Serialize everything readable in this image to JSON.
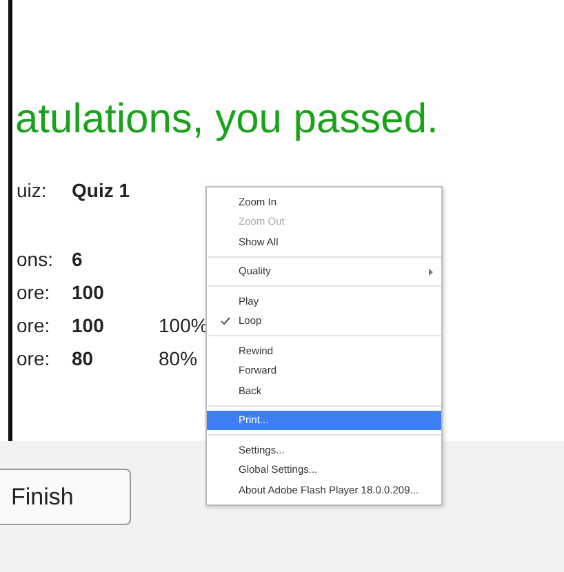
{
  "heading": "atulations, you passed.",
  "rows": [
    {
      "label": "uiz:",
      "value": "Quiz 1",
      "percent": ""
    },
    {
      "label": "ons:",
      "value": "6",
      "percent": ""
    },
    {
      "label": "ore:",
      "value": "100",
      "percent": ""
    },
    {
      "label": "ore:",
      "value": "100",
      "percent": "100%"
    },
    {
      "label": "ore:",
      "value": "80",
      "percent": "80%"
    }
  ],
  "finish_button": "Finish",
  "context_menu": [
    {
      "kind": "item",
      "label": "Zoom In",
      "disabled": false,
      "checked": false,
      "selected": false,
      "submenu": false
    },
    {
      "kind": "item",
      "label": "Zoom Out",
      "disabled": true,
      "checked": false,
      "selected": false,
      "submenu": false
    },
    {
      "kind": "item",
      "label": "Show All",
      "disabled": false,
      "checked": false,
      "selected": false,
      "submenu": false
    },
    {
      "kind": "separator"
    },
    {
      "kind": "item",
      "label": "Quality",
      "disabled": false,
      "checked": false,
      "selected": false,
      "submenu": true
    },
    {
      "kind": "separator"
    },
    {
      "kind": "item",
      "label": "Play",
      "disabled": false,
      "checked": false,
      "selected": false,
      "submenu": false
    },
    {
      "kind": "item",
      "label": "Loop",
      "disabled": false,
      "checked": true,
      "selected": false,
      "submenu": false
    },
    {
      "kind": "separator"
    },
    {
      "kind": "item",
      "label": "Rewind",
      "disabled": false,
      "checked": false,
      "selected": false,
      "submenu": false
    },
    {
      "kind": "item",
      "label": "Forward",
      "disabled": false,
      "checked": false,
      "selected": false,
      "submenu": false
    },
    {
      "kind": "item",
      "label": "Back",
      "disabled": false,
      "checked": false,
      "selected": false,
      "submenu": false
    },
    {
      "kind": "separator"
    },
    {
      "kind": "item",
      "label": "Print...",
      "disabled": false,
      "checked": false,
      "selected": true,
      "submenu": false
    },
    {
      "kind": "separator"
    },
    {
      "kind": "item",
      "label": "Settings...",
      "disabled": false,
      "checked": false,
      "selected": false,
      "submenu": false
    },
    {
      "kind": "item",
      "label": "Global Settings...",
      "disabled": false,
      "checked": false,
      "selected": false,
      "submenu": false
    },
    {
      "kind": "item",
      "label": "About Adobe Flash Player 18.0.0.209...",
      "disabled": false,
      "checked": false,
      "selected": false,
      "submenu": false
    }
  ]
}
